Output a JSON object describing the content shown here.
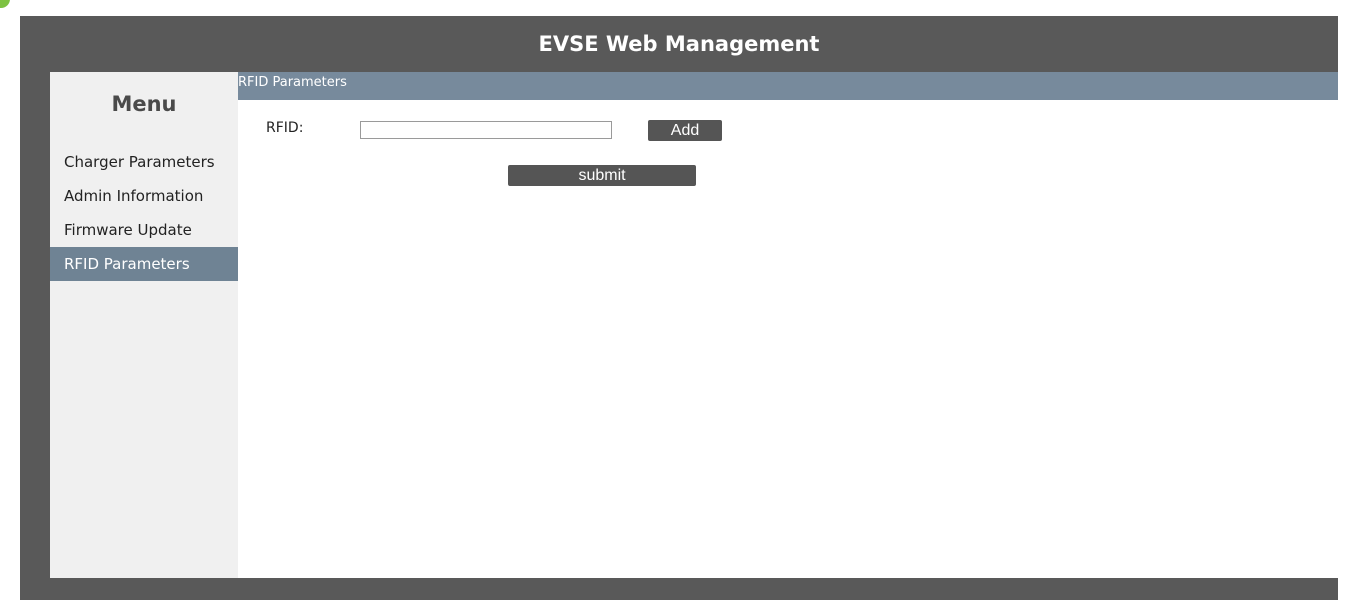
{
  "header": {
    "title": "EVSE Web Management"
  },
  "sidebar": {
    "title": "Menu",
    "items": [
      {
        "label": "Charger Parameters",
        "active": false
      },
      {
        "label": "Admin Information",
        "active": false
      },
      {
        "label": "Firmware Update",
        "active": false
      },
      {
        "label": "RFID Parameters",
        "active": true
      }
    ]
  },
  "main": {
    "section_title": "RFID Parameters",
    "rfid_label": "RFID:",
    "rfid_value": "",
    "add_label": "Add",
    "submit_label": "submit"
  },
  "colors": {
    "frame": "#595959",
    "sidebar_bg": "#f0f0f0",
    "active_item": "#6f8394",
    "section_bar": "#778a9c",
    "button": "#555555",
    "corner_dot": "#7dc242"
  },
  "icons": {
    "corner": "green-status-dot"
  }
}
